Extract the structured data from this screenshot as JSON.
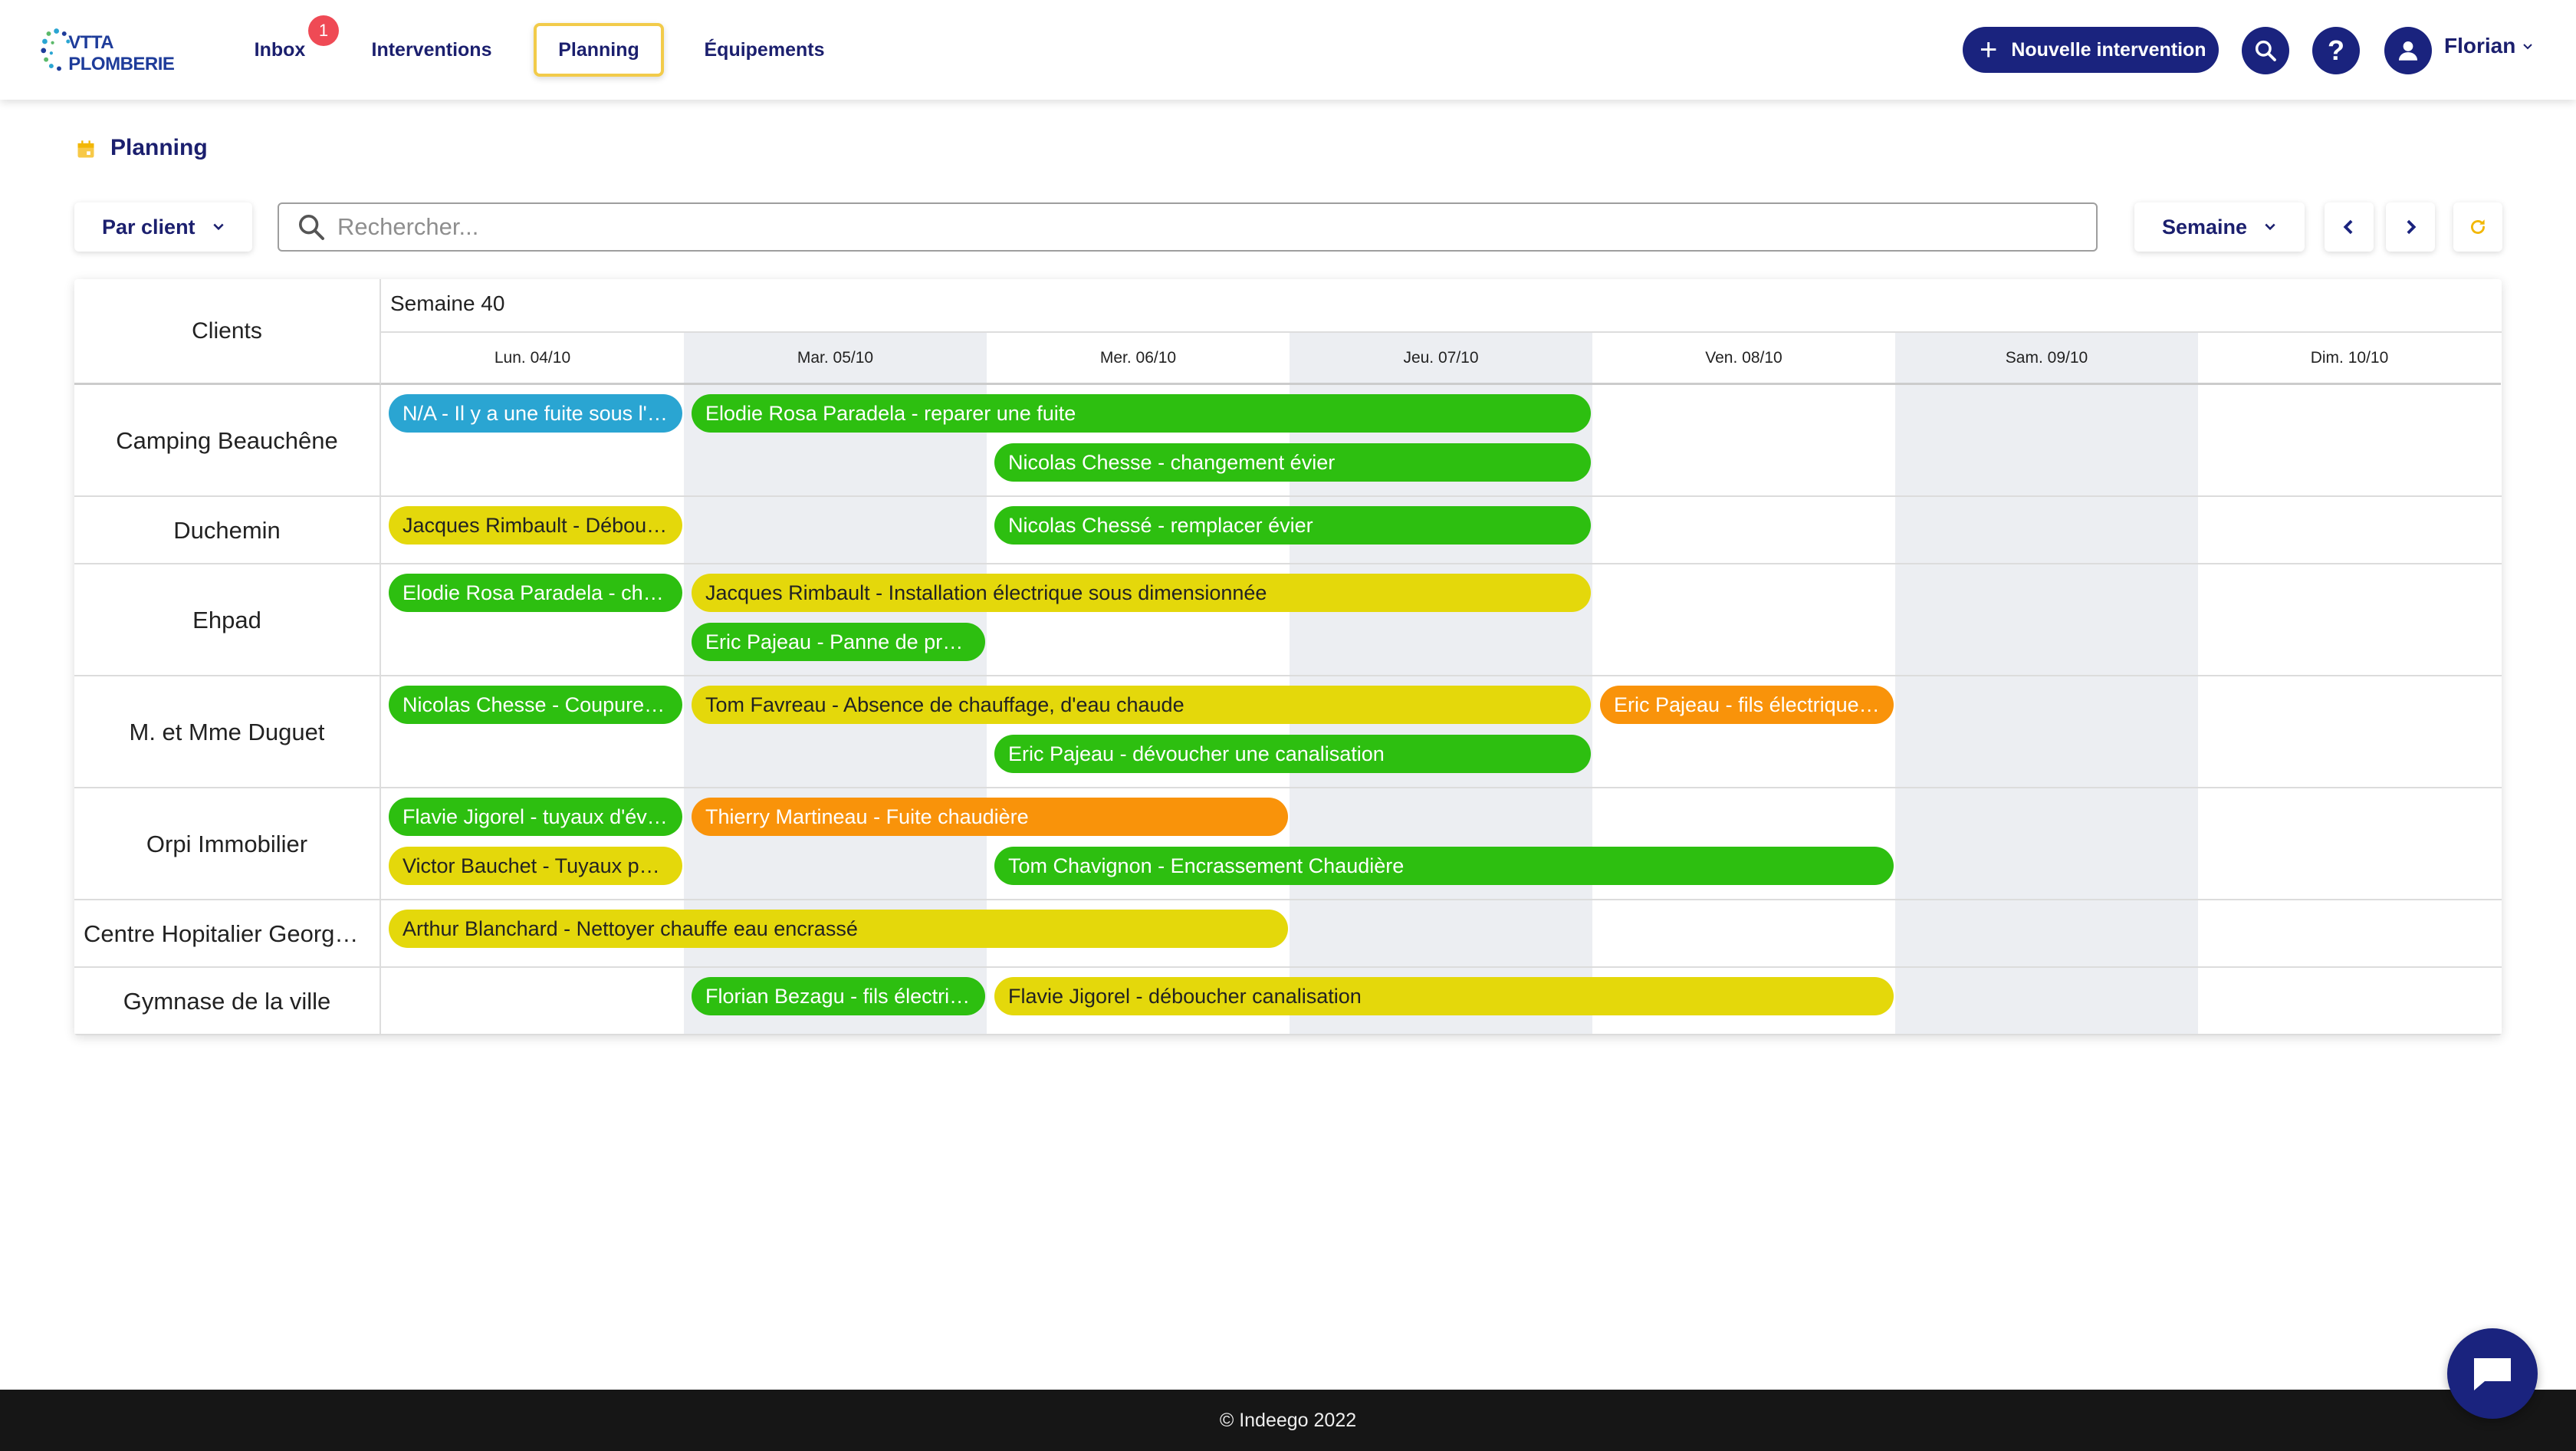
{
  "app": {
    "brand": "VTTA PLOMBERIE",
    "brand_colors": {
      "primary": "#1a237e",
      "accent": "#f2cb4a",
      "badge": "#ef4a55"
    }
  },
  "nav": {
    "inbox": "Inbox",
    "inbox_badge": "1",
    "interventions": "Interventions",
    "planning": "Planning",
    "equipements": "Équipements",
    "active": "planning"
  },
  "header": {
    "new_intervention": "Nouvelle intervention",
    "search_icon": "search-icon",
    "help_icon": "help-icon",
    "user_name": "Florian"
  },
  "page": {
    "title": "Planning"
  },
  "toolbar": {
    "group_by": "Par client",
    "search_placeholder": "Rechercher...",
    "view_mode": "Semaine"
  },
  "planning": {
    "clients_header": "Clients",
    "week_label": "Semaine 40",
    "days": [
      "Lun. 04/10",
      "Mar. 05/10",
      "Mer. 06/10",
      "Jeu. 07/10",
      "Ven. 08/10",
      "Sam. 09/10",
      "Dim. 10/10"
    ],
    "shaded_days": [
      1,
      3,
      5
    ],
    "rows": [
      {
        "client": "Camping Beauchêne",
        "lanes": 2,
        "events": [
          {
            "label": "N/A - Il y a une fuite sous l'évier",
            "start": 0,
            "span": 1,
            "lane": 0,
            "color": "blue"
          },
          {
            "label": "Elodie Rosa Paradela - reparer une fuite",
            "start": 1,
            "span": 3,
            "lane": 0,
            "color": "green"
          },
          {
            "label": "Nicolas Chesse - changement évier",
            "start": 2,
            "span": 2,
            "lane": 1,
            "color": "green"
          }
        ]
      },
      {
        "client": "Duchemin",
        "lanes": 1,
        "events": [
          {
            "label": "Jacques Rimbault - Déboucher canalisation",
            "start": 0,
            "span": 1,
            "lane": 0,
            "color": "yellow"
          },
          {
            "label": "Nicolas Chessé - remplacer évier",
            "start": 2,
            "span": 2,
            "lane": 0,
            "color": "green"
          }
        ]
      },
      {
        "client": "Ehpad",
        "lanes": 2,
        "events": [
          {
            "label": "Elodie Rosa Paradela - changer robinet",
            "start": 0,
            "span": 1,
            "lane": 0,
            "color": "green"
          },
          {
            "label": "Jacques Rimbault - Installation électrique sous dimensionnée",
            "start": 1,
            "span": 3,
            "lane": 0,
            "color": "yellow"
          },
          {
            "label": "Eric Pajeau - Panne de pression",
            "start": 1,
            "span": 1,
            "lane": 1,
            "color": "green"
          }
        ]
      },
      {
        "client": "M. et Mme Duguet",
        "lanes": 2,
        "events": [
          {
            "label": "Nicolas Chesse - Coupure d'eau",
            "start": 0,
            "span": 1,
            "lane": 0,
            "color": "green"
          },
          {
            "label": "Tom Favreau - Absence de chauffage, d'eau chaude",
            "start": 1,
            "span": 3,
            "lane": 0,
            "color": "yellow"
          },
          {
            "label": "Eric Pajeau - fils électriques dénudés",
            "start": 4,
            "span": 1,
            "lane": 0,
            "color": "orange"
          },
          {
            "label": "Eric Pajeau - dévoucher une canalisation",
            "start": 2,
            "span": 2,
            "lane": 1,
            "color": "green"
          }
        ]
      },
      {
        "client": "Orpi Immobilier",
        "lanes": 2,
        "events": [
          {
            "label": "Flavie Jigorel - tuyaux d'évacuation",
            "start": 0,
            "span": 1,
            "lane": 0,
            "color": "green"
          },
          {
            "label": "Thierry Martineau - Fuite chaudière",
            "start": 1,
            "span": 2,
            "lane": 0,
            "color": "orange"
          },
          {
            "label": "Victor Bauchet - Tuyaux percés",
            "start": 0,
            "span": 1,
            "lane": 1,
            "color": "yellow"
          },
          {
            "label": "Tom Chavignon - Encrassement Chaudière",
            "start": 2,
            "span": 3,
            "lane": 1,
            "color": "green"
          }
        ]
      },
      {
        "client": "Centre Hopitalier Georges Mazurelle",
        "lanes": 1,
        "events": [
          {
            "label": "Arthur Blanchard - Nettoyer chauffe eau encrassé",
            "start": 0,
            "span": 3,
            "lane": 0,
            "color": "yellow"
          }
        ]
      },
      {
        "client": "Gymnase de la ville",
        "lanes": 1,
        "events": [
          {
            "label": "Florian Bezagu - fils électriques",
            "start": 1,
            "span": 1,
            "lane": 0,
            "color": "green"
          },
          {
            "label": "Flavie Jigorel - déboucher canalisation",
            "start": 2,
            "span": 3,
            "lane": 0,
            "color": "yellow"
          }
        ]
      }
    ]
  },
  "footer": {
    "text": "© Indeego 2022"
  }
}
